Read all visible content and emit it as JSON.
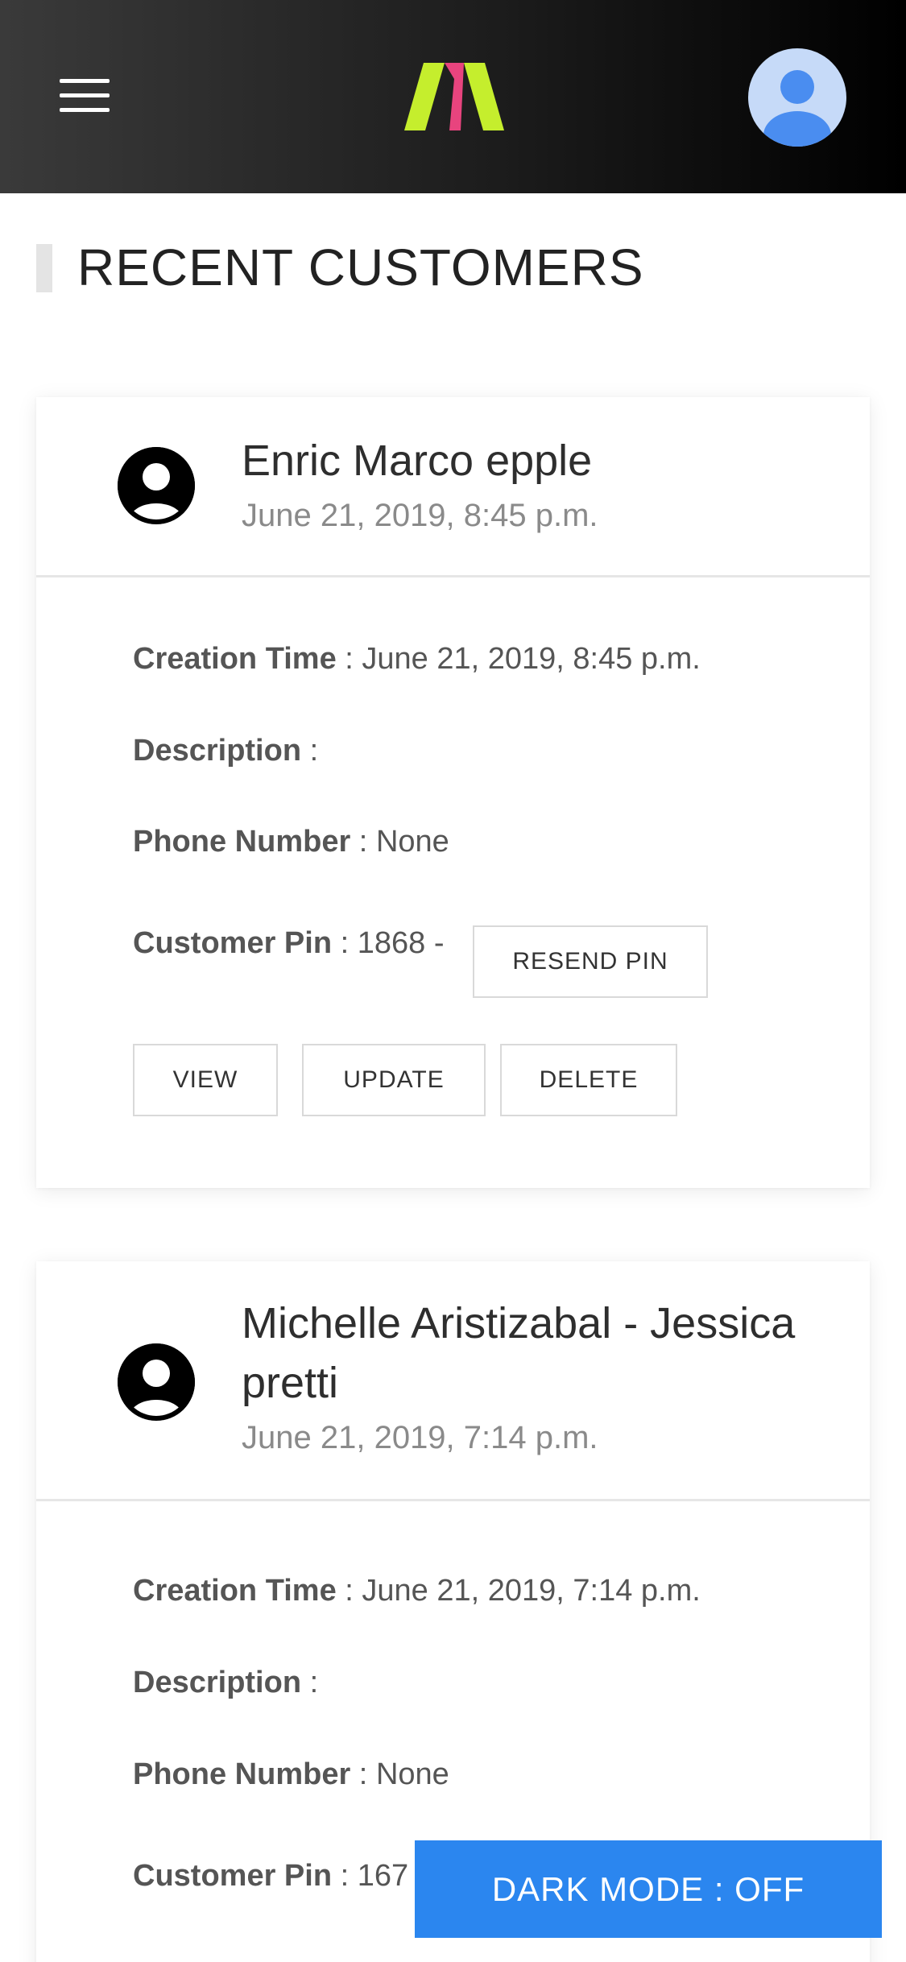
{
  "header": {
    "menu_icon": "hamburger-menu-icon",
    "logo": "brand-logo",
    "avatar_icon": "user-avatar-icon",
    "colors": {
      "logo_green": "#c5ee2d",
      "logo_pink": "#e8447e",
      "avatar_bg": "#c6daf8",
      "avatar_fg": "#4a8df0"
    }
  },
  "page": {
    "title": "RECENT CUSTOMERS"
  },
  "labels": {
    "creation_time": "Creation Time",
    "description": "Description",
    "phone_number": "Phone Number",
    "customer_pin": "Customer Pin",
    "separator": " : "
  },
  "buttons": {
    "resend_pin": "RESEND PIN",
    "view": "VIEW",
    "update": "UPDATE",
    "delete": "DELETE"
  },
  "customers": [
    {
      "name": "Enric Marco epple",
      "date": "June 21, 2019, 8:45 p.m.",
      "creation_time": "June 21, 2019, 8:45 p.m.",
      "description": "",
      "phone_number": "None",
      "pin": "1868 -"
    },
    {
      "name": "Michelle Aristizabal - Jessica pretti",
      "date": "June 21, 2019, 7:14 p.m.",
      "creation_time": "June 21, 2019, 7:14 p.m.",
      "description": "",
      "phone_number": "None",
      "pin": "167"
    }
  ],
  "dark_mode": {
    "label": "DARK MODE : OFF",
    "color": "#2b86ef"
  }
}
